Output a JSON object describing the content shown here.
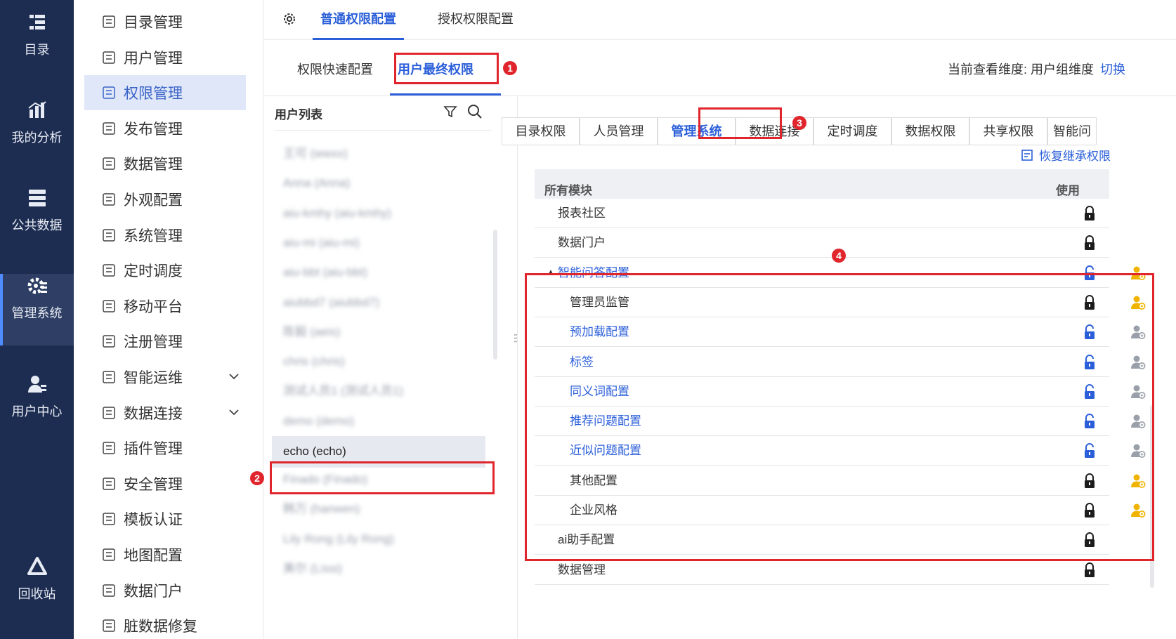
{
  "nav": {
    "items": [
      {
        "label": "目录",
        "icon": "catalog-icon"
      },
      {
        "label": "我的分析",
        "icon": "analysis-icon"
      },
      {
        "label": "公共数据",
        "icon": "database-icon"
      },
      {
        "label": "管理系统",
        "icon": "settings-icon"
      },
      {
        "label": "用户中心",
        "icon": "user-center-icon"
      },
      {
        "label": "回收站",
        "icon": "recycle-icon"
      }
    ]
  },
  "menu": {
    "items": [
      {
        "label": "目录管理"
      },
      {
        "label": "用户管理"
      },
      {
        "label": "权限管理"
      },
      {
        "label": "发布管理"
      },
      {
        "label": "数据管理"
      },
      {
        "label": "外观配置"
      },
      {
        "label": "系统管理"
      },
      {
        "label": "定时调度"
      },
      {
        "label": "移动平台"
      },
      {
        "label": "注册管理"
      },
      {
        "label": "智能运维"
      },
      {
        "label": "数据连接"
      },
      {
        "label": "插件管理"
      },
      {
        "label": "安全管理"
      },
      {
        "label": "模板认证"
      },
      {
        "label": "地图配置"
      },
      {
        "label": "数据门户"
      },
      {
        "label": "脏数据修复"
      }
    ]
  },
  "top_tabs": [
    "普通权限配置",
    "授权权限配置"
  ],
  "sub_tabs": {
    "quick": "权限快速配置",
    "final": "用户最终权限"
  },
  "dimension": {
    "label": "当前查看维度: 用户组维度",
    "switch": "切换"
  },
  "badges": [
    "1",
    "2",
    "3",
    "4"
  ],
  "user_list": {
    "title": "用户列表",
    "items": [
      "王可 (wwxx)",
      "Anna (Anna)",
      "aiu-kmhy (aiu-kmhy)",
      "aiu-mi (aiu-mi)",
      "aiu-bbt (aiu-bbt)",
      "aiubbd7 (aiubbd7)",
      "陈毅 (aeis)",
      "chris (chris)",
      "测试人员1 (测试人员1)",
      "demo (demo)"
    ],
    "selected": "echo (echo)",
    "after": [
      "Finado (Finado)",
      "韩万 (hanwen)",
      "Lily Rong (Lily Rong)",
      "美尔 (Lissi)"
    ]
  },
  "module_tabs": [
    "目录权限",
    "人员管理",
    "管理系统",
    "数据连接",
    "定时调度",
    "数据权限",
    "共享权限",
    "智能问答"
  ],
  "restore": "恢复继承权限",
  "grid": {
    "header": {
      "module": "所有模块",
      "use": "使用"
    },
    "rows": [
      {
        "name": "报表社区",
        "link": false,
        "indent": 0,
        "lock": "locked",
        "person": ""
      },
      {
        "name": "数据门户",
        "link": false,
        "indent": 0,
        "lock": "locked",
        "person": ""
      },
      {
        "name": "智能问答配置",
        "link": true,
        "indent": 0,
        "lock": "unlocked",
        "person": "gold",
        "expand": true
      },
      {
        "name": "管理员监管",
        "link": false,
        "indent": 1,
        "lock": "locked",
        "person": "gold"
      },
      {
        "name": "预加载配置",
        "link": true,
        "indent": 1,
        "lock": "unlocked",
        "person": "gray"
      },
      {
        "name": "标签",
        "link": true,
        "indent": 1,
        "lock": "unlocked",
        "person": "gray"
      },
      {
        "name": "同义词配置",
        "link": true,
        "indent": 1,
        "lock": "unlocked",
        "person": "gray"
      },
      {
        "name": "推荐问题配置",
        "link": true,
        "indent": 1,
        "lock": "unlocked",
        "person": "gray"
      },
      {
        "name": "近似问题配置",
        "link": true,
        "indent": 1,
        "lock": "unlocked",
        "person": "gray"
      },
      {
        "name": "其他配置",
        "link": false,
        "indent": 1,
        "lock": "locked",
        "person": "gold"
      },
      {
        "name": "企业风格",
        "link": false,
        "indent": 1,
        "lock": "locked",
        "person": "gold"
      },
      {
        "name": "ai助手配置",
        "link": false,
        "indent": 0,
        "lock": "locked",
        "person": ""
      },
      {
        "name": "数据管理",
        "link": false,
        "indent": 0,
        "lock": "locked",
        "person": ""
      }
    ]
  },
  "colors": {
    "accent": "#2b5fd9",
    "nav_bg": "#1d2c51",
    "highlight": "#e0262c",
    "gold": "#f0b400"
  }
}
